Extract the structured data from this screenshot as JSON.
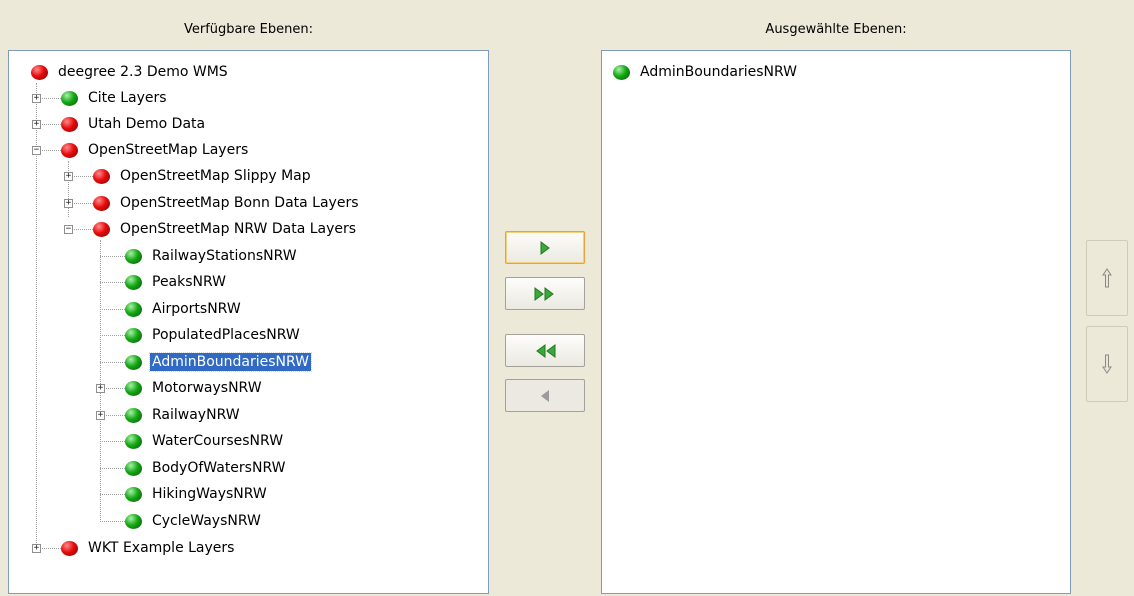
{
  "available": {
    "heading": "Verfügbare Ebenen:",
    "tree": [
      {
        "label": "deegree 2.3 Demo WMS",
        "status": "red"
      },
      {
        "label": "Cite Layers",
        "status": "green",
        "expander": "+"
      },
      {
        "label": "Utah Demo Data",
        "status": "red",
        "expander": "+"
      },
      {
        "label": "OpenStreetMap Layers",
        "status": "red",
        "expander": "-"
      },
      {
        "label": "OpenStreetMap Slippy Map",
        "status": "red",
        "expander": "+"
      },
      {
        "label": "OpenStreetMap Bonn Data Layers",
        "status": "red",
        "expander": "+"
      },
      {
        "label": "OpenStreetMap NRW Data Layers",
        "status": "red",
        "expander": "-"
      },
      {
        "label": "RailwayStationsNRW",
        "status": "green"
      },
      {
        "label": "PeaksNRW",
        "status": "green"
      },
      {
        "label": "AirportsNRW",
        "status": "green"
      },
      {
        "label": "PopulatedPlacesNRW",
        "status": "green"
      },
      {
        "label": "AdminBoundariesNRW",
        "status": "green",
        "selected": true
      },
      {
        "label": "MotorwaysNRW",
        "status": "green",
        "expander": "+"
      },
      {
        "label": "RailwayNRW",
        "status": "green",
        "expander": "+"
      },
      {
        "label": "WaterCoursesNRW",
        "status": "green"
      },
      {
        "label": "BodyOfWatersNRW",
        "status": "green"
      },
      {
        "label": "HikingWaysNRW",
        "status": "green"
      },
      {
        "label": "CycleWaysNRW",
        "status": "green"
      },
      {
        "label": "WKT Example Layers",
        "status": "red",
        "expander": "+"
      }
    ]
  },
  "selected": {
    "heading": "Ausgewählte Ebenen:",
    "items": [
      {
        "label": "AdminBoundariesNRW",
        "status": "green"
      }
    ]
  },
  "buttons": {
    "add": {
      "icon": "arrow-right-icon",
      "enabled": true,
      "focused": true
    },
    "add_all": {
      "icon": "double-arrow-right-icon",
      "enabled": true
    },
    "remove_all": {
      "icon": "double-arrow-left-icon",
      "enabled": true
    },
    "remove": {
      "icon": "arrow-left-icon",
      "enabled": false
    },
    "move_up": {
      "icon": "arrow-up-icon",
      "enabled": false
    },
    "move_down": {
      "icon": "arrow-down-icon",
      "enabled": false
    }
  },
  "colors": {
    "accent_green": "#15a815",
    "status_red": "#e80b0b",
    "status_green": "#15a815",
    "selection": "#316ac5"
  }
}
